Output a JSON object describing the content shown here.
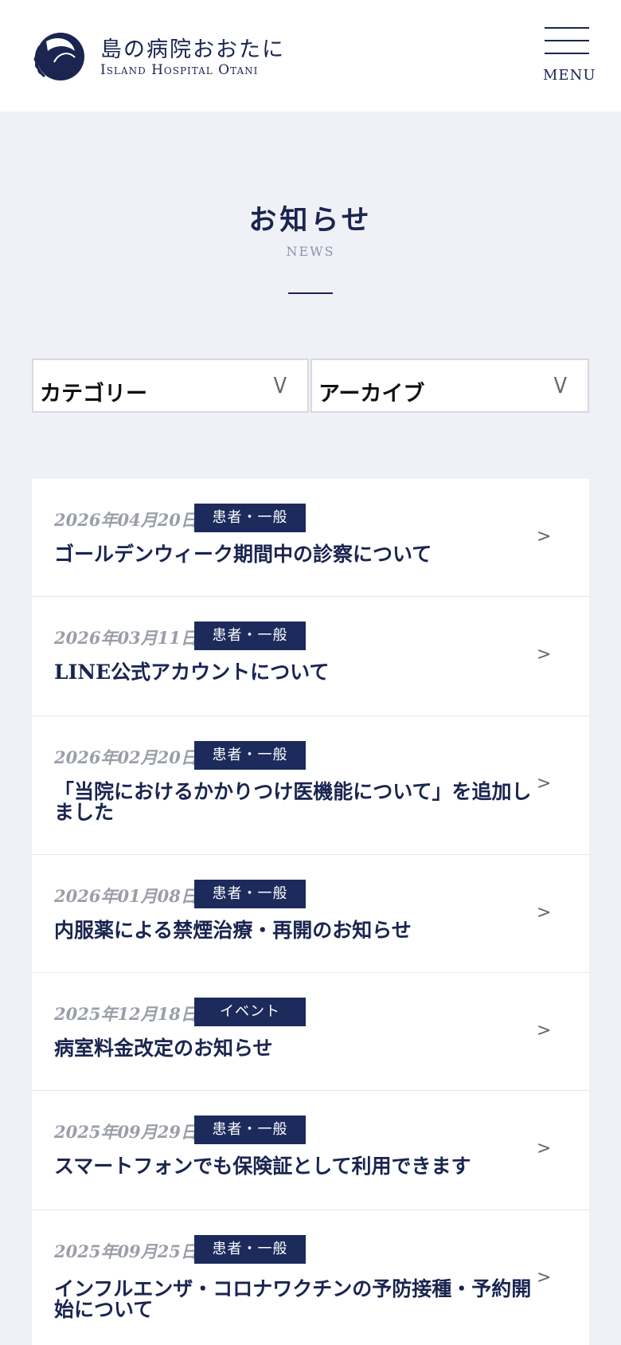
{
  "header": {
    "logo_icon": "hospital-logo-icon",
    "site_name_ja": "島の病院おおたに",
    "site_name_en": "Island Hospital Otani",
    "menu_label": "MENU",
    "brand_color": "#1a2550"
  },
  "page": {
    "title": "お知らせ",
    "subtitle": "NEWS"
  },
  "filters": {
    "category_label": "カテゴリー",
    "archive_label": "アーカイブ",
    "chevron": "V"
  },
  "news": {
    "arrow": ">",
    "badge_color": "#1c2b5c",
    "items": [
      {
        "date": "2026年04月20日",
        "category": "患者・一般",
        "title": "ゴールデンウィーク期間中の診察について"
      },
      {
        "date": "2026年03月11日",
        "category": "患者・一般",
        "title": "LINE公式アカウントについて"
      },
      {
        "date": "2026年02月20日",
        "category": "患者・一般",
        "title": "「当院におけるかかりつけ医機能について」を追加しました"
      },
      {
        "date": "2026年01月08日",
        "category": "患者・一般",
        "title": "内服薬による禁煙治療・再開のお知らせ"
      },
      {
        "date": "2025年12月18日",
        "category": "イベント",
        "title": "病室料金改定のお知らせ"
      },
      {
        "date": "2025年09月29日",
        "category": "患者・一般",
        "title": "スマートフォンでも保険証として利用できます"
      },
      {
        "date": "2025年09月25日",
        "category": "患者・一般",
        "title": "インフルエンザ・コロナワクチンの予防接種・予約開始について"
      }
    ]
  }
}
